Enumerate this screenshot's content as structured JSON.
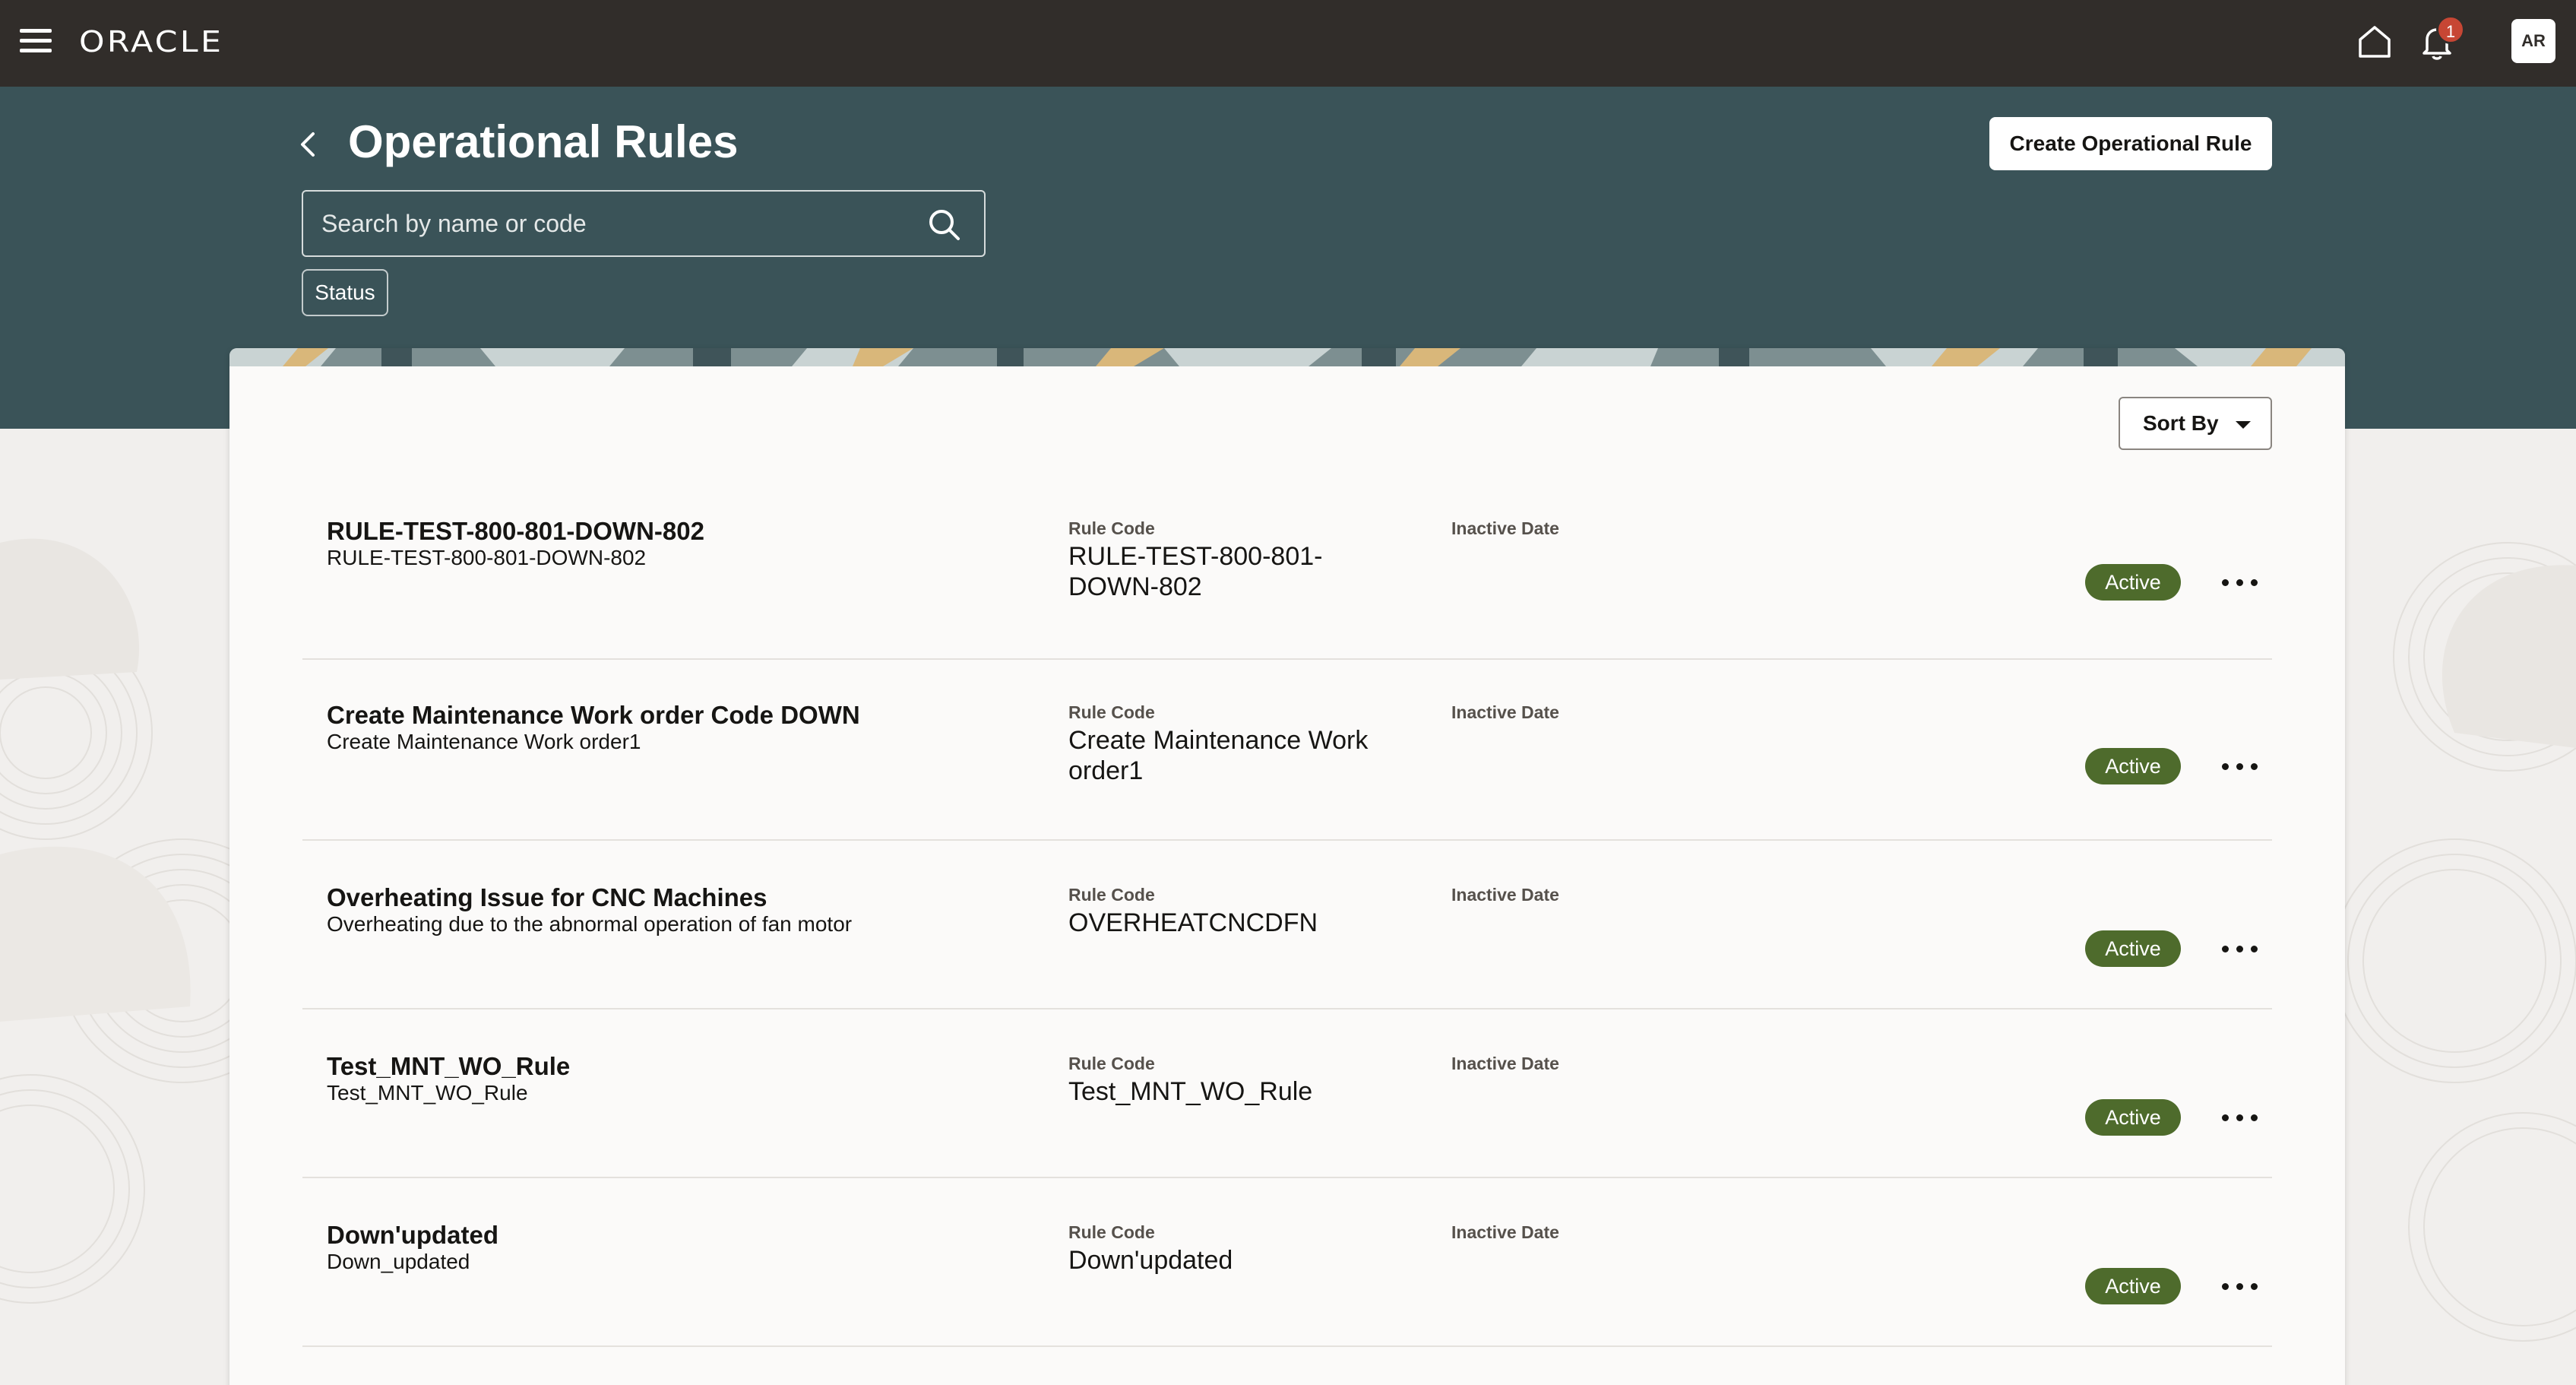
{
  "topbar": {
    "logo_text": "ORACLE",
    "notification_count": "1",
    "avatar_initials": "AR"
  },
  "header": {
    "title": "Operational Rules",
    "create_button_label": "Create Operational Rule",
    "search_placeholder": "Search by name or code",
    "status_filter_label": "Status"
  },
  "toolbar": {
    "sort_label": "Sort By"
  },
  "labels": {
    "rule_code": "Rule Code",
    "inactive_date": "Inactive Date"
  },
  "rules": [
    {
      "name": "RULE-TEST-800-801-DOWN-802",
      "description": "RULE-TEST-800-801-DOWN-802",
      "code": "RULE-TEST-800-801-DOWN-802",
      "inactive_date": "",
      "status": "Active"
    },
    {
      "name": "Create Maintenance Work order Code DOWN",
      "description": "Create Maintenance Work order1",
      "code": "Create Maintenance Work order1",
      "inactive_date": "",
      "status": "Active"
    },
    {
      "name": "Overheating Issue for CNC Machines",
      "description": "Overheating due to the abnormal operation of fan motor",
      "code": "OVERHEATCNCDFN",
      "inactive_date": "",
      "status": "Active"
    },
    {
      "name": "Test_MNT_WO_Rule",
      "description": "Test_MNT_WO_Rule",
      "code": "Test_MNT_WO_Rule",
      "inactive_date": "",
      "status": "Active"
    },
    {
      "name": "Down'updated",
      "description": "Down_updated",
      "code": "Down'updated",
      "inactive_date": "",
      "status": "Active"
    }
  ],
  "colors": {
    "topbar": "#312d2a",
    "header_band": "#3a5358",
    "status_active": "#4e6b2c",
    "badge": "#c74634"
  },
  "icons": [
    "hamburger-menu-icon",
    "home-icon",
    "bell-icon",
    "back-chevron-icon",
    "search-icon",
    "caret-down-icon",
    "more-actions-icon"
  ]
}
